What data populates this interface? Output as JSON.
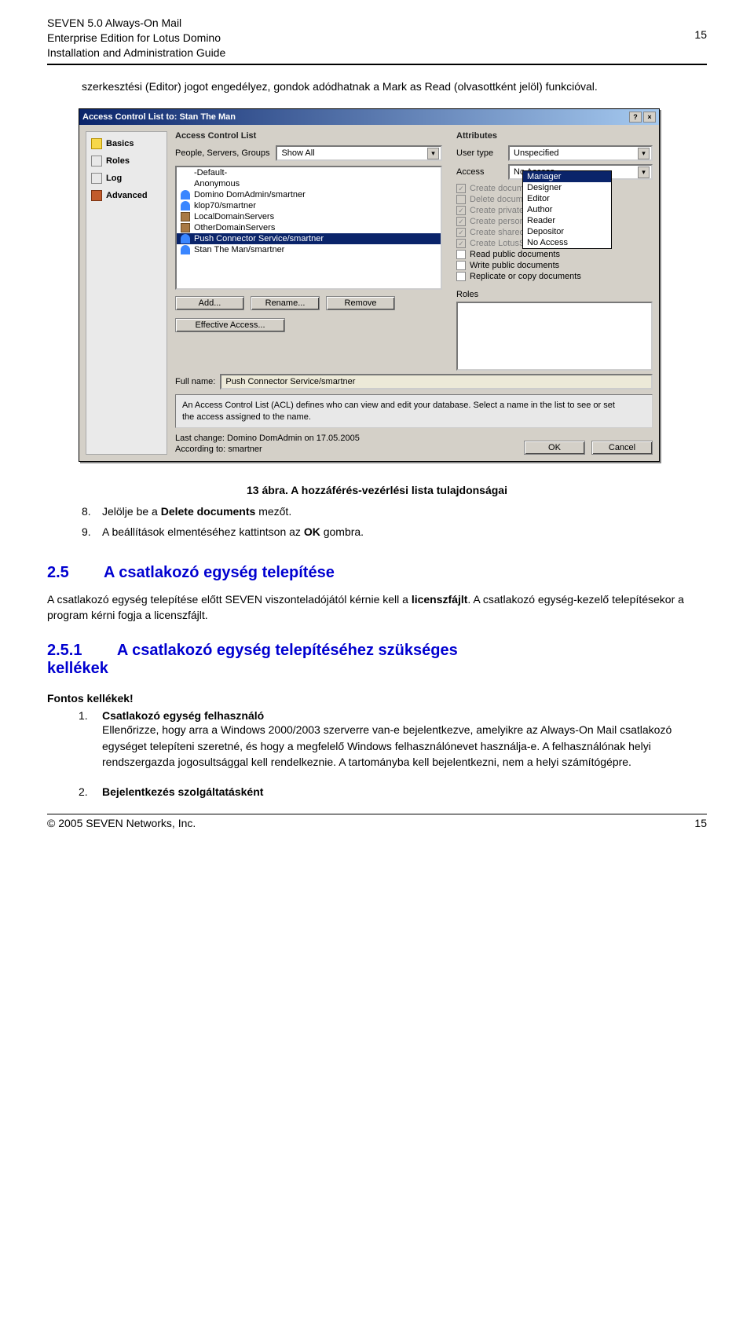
{
  "header": {
    "line1": "SEVEN 5.0 Always-On Mail",
    "line2": "Enterprise Edition for Lotus Domino",
    "line3": "Installation and Administration Guide",
    "page_top": "15"
  },
  "intro_para": "szerkesztési (Editor) jogot engedélyez, gondok adódhatnak a Mark as Read (olvasottként jelöl) funkcióval.",
  "dialog": {
    "title": "Access Control List to: Stan The Man",
    "help_btn": "?",
    "close_btn": "×",
    "leftnav": {
      "basics": "Basics",
      "roles": "Roles",
      "log": "Log",
      "advanced": "Advanced"
    },
    "acl_section_title": "Access Control List",
    "psg_label": "People, Servers, Groups",
    "psg_value": "Show All",
    "list_items": [
      {
        "icon": "none",
        "label": "-Default-"
      },
      {
        "icon": "none",
        "label": "Anonymous"
      },
      {
        "icon": "person",
        "label": "Domino DomAdmin/smartner"
      },
      {
        "icon": "person",
        "label": "klop70/smartner"
      },
      {
        "icon": "servers",
        "label": "LocalDomainServers"
      },
      {
        "icon": "servers",
        "label": "OtherDomainServers"
      },
      {
        "icon": "person",
        "label": "Push Connector Service/smartner",
        "selected": true
      },
      {
        "icon": "person",
        "label": "Stan The Man/smartner"
      }
    ],
    "btn_add": "Add...",
    "btn_rename": "Rename...",
    "btn_remove": "Remove",
    "btn_eff": "Effective Access...",
    "fullname_label": "Full name:",
    "fullname_value": "Push Connector Service/smartner",
    "info_text": "An Access Control List (ACL) defines who can view and edit your database. Select a name in the list to see or set the access assigned to the name.",
    "last_change": "Last change: Domino DomAdmin on 17.05.2005",
    "according_to": "According to: smartner",
    "btn_ok": "OK",
    "btn_cancel": "Cancel",
    "attr_section_title": "Attributes",
    "usertype_label": "User type",
    "usertype_value": "Unspecified",
    "access_label": "Access",
    "access_value": "No Access",
    "access_options": [
      "Manager",
      "Designer",
      "Editor",
      "Author",
      "Reader",
      "Depositor",
      "No Access"
    ],
    "checks": [
      "Create documents",
      "Delete documents",
      "Create private agents",
      "Create personal folders/views",
      "Create shared folders/views",
      "Create LotusScript/Java agents",
      "Read public documents",
      "Write public documents",
      "Replicate or copy documents"
    ],
    "roles_label": "Roles"
  },
  "caption": "13 ábra. A hozzáférés-vezérlési lista tulajdonságai",
  "step8": "Jelölje be a Delete documents mezőt.",
  "step9": "A beállítások elmentéséhez kattintson az OK gombra.",
  "h25_num": "2.5",
  "h25_txt": "A csatlakozó egység telepítése",
  "h25_body": "A csatlakozó egység telepítése előtt SEVEN viszonteladójától kérnie kell a licenszfájlt. A csatlakozó egység-kezelő telepítésekor a program kérni fogja a licenszfájlt.",
  "h251_num": "2.5.1",
  "h251_txt": "A csatlakozó egység telepítéséhez szükséges kellékek",
  "fk_title": "Fontos kellékek!",
  "li1_title": "Csatlakozó egység felhasználó",
  "li1_body": "Ellenőrizze, hogy arra a Windows 2000/2003 szerverre van-e bejelentkezve, amelyikre az Always-On Mail csatlakozó egységet telepíteni szeretné, és hogy a megfelelő Windows felhasználónevet használja-e. A felhasználónak helyi rendszergazda jogosultsággal kell rendelkeznie. A tartományba kell bejelentkezni, nem a helyi számítógépre.",
  "li2_title": "Bejelentkezés szolgáltatásként",
  "footer": {
    "left": "© 2005 SEVEN Networks, Inc.",
    "right": "15"
  }
}
